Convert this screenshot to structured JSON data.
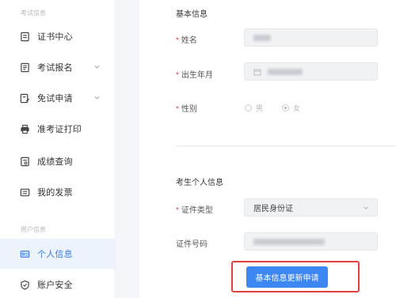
{
  "sidebar": {
    "group_exam": "考试信息",
    "group_user": "用户信息",
    "items": [
      {
        "label": "证书中心",
        "icon": "certificate-icon"
      },
      {
        "label": "考试报名",
        "icon": "exam-register-icon",
        "expandable": true
      },
      {
        "label": "免试申请",
        "icon": "exemption-icon",
        "expandable": true
      },
      {
        "label": "准考证打印",
        "icon": "printer-icon"
      },
      {
        "label": "成绩查询",
        "icon": "score-icon"
      },
      {
        "label": "我的发票",
        "icon": "invoice-icon"
      },
      {
        "label": "个人信息",
        "icon": "id-card-icon",
        "active": true
      },
      {
        "label": "账户安全",
        "icon": "shield-icon"
      }
    ]
  },
  "form": {
    "basic_title": "基本信息",
    "name_label": "姓名",
    "birth_label": "出生年月",
    "gender_label": "性别",
    "gender_male": "男",
    "gender_female": "女",
    "gender_selected": "女",
    "personal_title": "考生个人信息",
    "id_type_label": "证件类型",
    "id_type_value": "居民身份证",
    "id_number_label": "证件号码",
    "submit_button": "基本信息更新申请"
  },
  "colors": {
    "accent": "#3d87f5",
    "active_bg": "#edf3fd",
    "required": "#e54545",
    "highlight": "#e34040"
  }
}
